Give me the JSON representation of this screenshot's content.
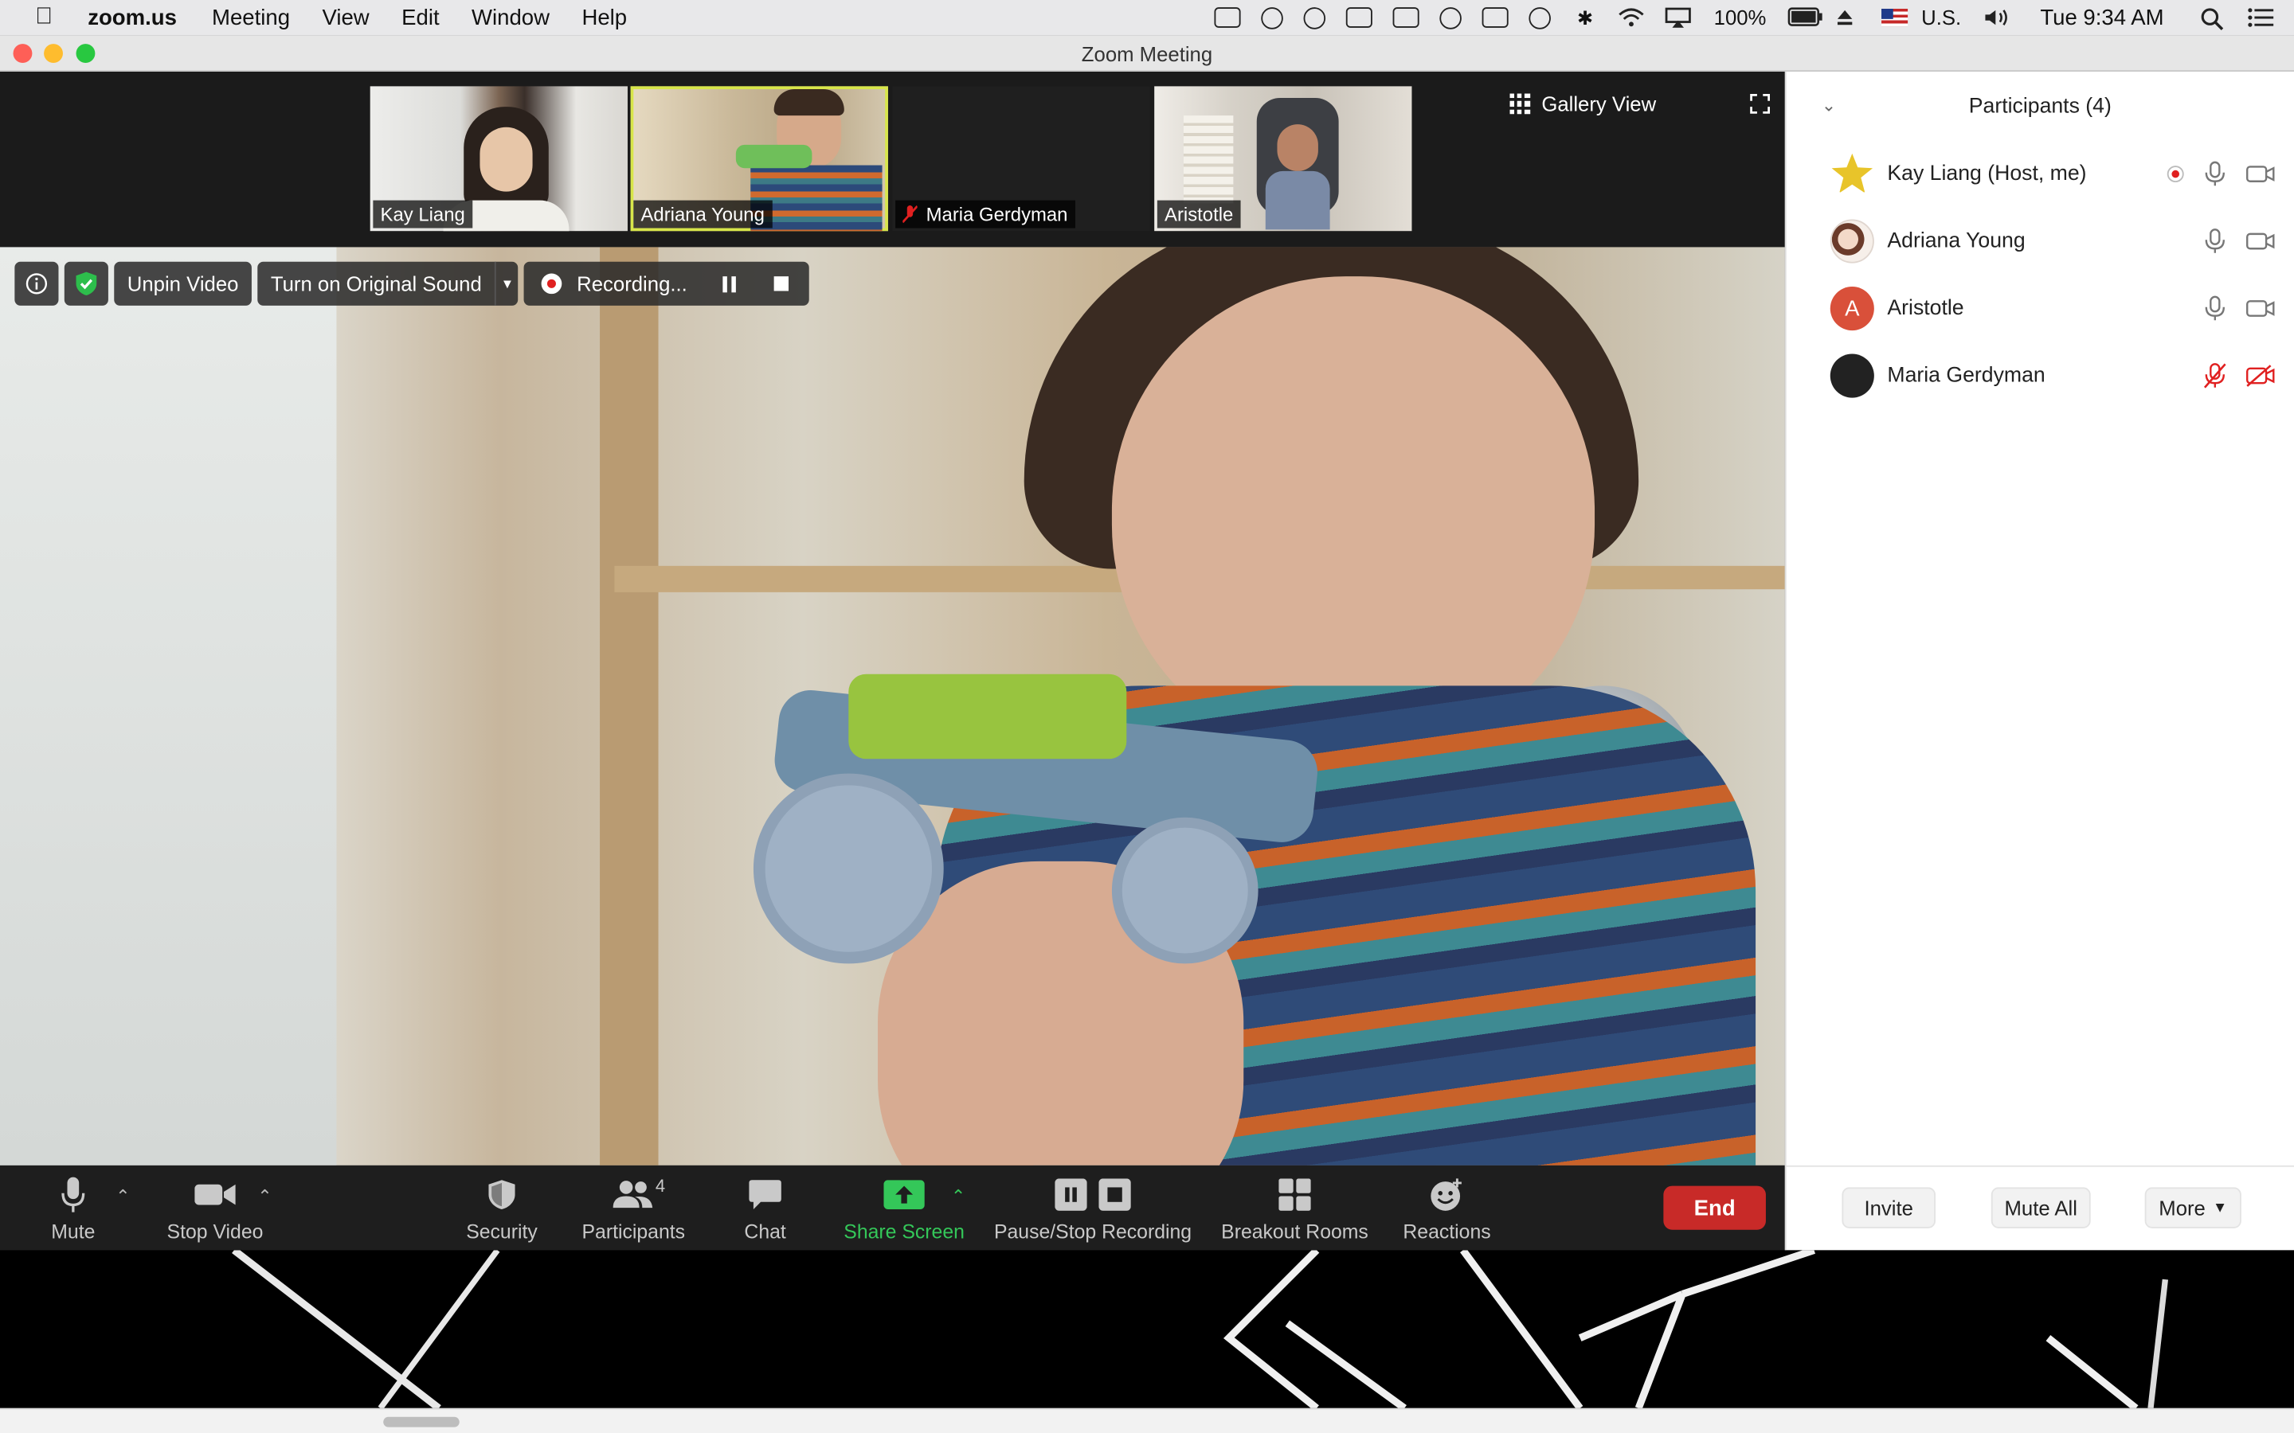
{
  "menubar": {
    "app_name": "zoom.us",
    "menus": [
      "Meeting",
      "View",
      "Edit",
      "Window",
      "Help"
    ],
    "battery": "100%",
    "input_source": "U.S.",
    "clock": "Tue 9:34 AM"
  },
  "window": {
    "title": "Zoom Meeting"
  },
  "gallery_strip": {
    "tiles": [
      {
        "name": "Kay Liang",
        "muted": false
      },
      {
        "name": "Adriana Young",
        "muted": false
      },
      {
        "name": "Maria Gerdyman",
        "muted": true
      },
      {
        "name": "Aristotle",
        "muted": false
      }
    ],
    "active_speaker": "Adriana Young",
    "view_label": "Gallery View"
  },
  "video_overlay": {
    "unpin_label": "Unpin Video",
    "original_sound_label": "Turn on Original Sound",
    "recording_label": "Recording..."
  },
  "toolbar": {
    "mute": "Mute",
    "stop_video": "Stop Video",
    "security": "Security",
    "participants": "Participants",
    "participants_count": "4",
    "chat": "Chat",
    "share_screen": "Share Screen",
    "pause_stop_recording": "Pause/Stop Recording",
    "breakout_rooms": "Breakout Rooms",
    "reactions": "Reactions",
    "end": "End"
  },
  "panel": {
    "title": "Participants (4)",
    "participants": [
      {
        "name": "Kay Liang (Host, me)",
        "avatar": "star",
        "recording": true,
        "mic_muted": false,
        "video_off": false
      },
      {
        "name": "Adriana Young",
        "avatar": "photo",
        "recording": false,
        "mic_muted": false,
        "video_off": false
      },
      {
        "name": "Aristotle",
        "avatar": "letter",
        "initial": "A",
        "recording": false,
        "mic_muted": false,
        "video_off": false
      },
      {
        "name": "Maria Gerdyman",
        "avatar": "dark",
        "recording": false,
        "mic_muted": true,
        "video_off": true
      }
    ],
    "invite": "Invite",
    "mute_all": "Mute All",
    "more": "More"
  },
  "colors": {
    "end_red": "#c82a28",
    "share_green": "#34c759",
    "active_speaker_outline": "#d8e64a",
    "muted_red": "#e02020",
    "aristotle_avatar": "#d9503a"
  }
}
